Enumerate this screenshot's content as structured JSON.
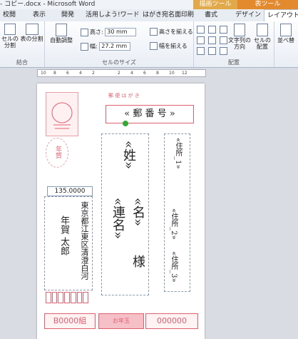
{
  "title": "- コピー.docx - Microsoft Word",
  "context_tabs": {
    "drawing": "描画ツール",
    "table": "表ツール"
  },
  "tabs": [
    "校閲",
    "表示",
    "開発",
    "活用しよう!ワード",
    "はがき宛名面印刷",
    "書式",
    "デザイン",
    "レイアウト"
  ],
  "ribbon": {
    "merge": {
      "split_cells": "セルの\n分割",
      "split_table": "表の分割",
      "label": "結合"
    },
    "size": {
      "autofit": "自動調整",
      "height_label": "高さ:",
      "height_value": "30 mm",
      "width_label": "幅:",
      "width_value": "27.2 mm",
      "distribute_rows": "高さを揃える",
      "distribute_cols": "幅を揃える",
      "label": "セルのサイズ"
    },
    "align": {
      "text_direction": "文字列の\n方向",
      "cell_margins": "セルの\n配置",
      "label": "配置"
    },
    "sort": "並べ替"
  },
  "ruler_numbers": [
    "10",
    "8",
    "6",
    "4",
    "2",
    "",
    "2",
    "4",
    "6",
    "8",
    "10",
    "12"
  ],
  "postcard": {
    "header": "郵 便 は が き",
    "postal_box": "« 郵 番 号 »",
    "nenga": "年賀",
    "amount": "135.0000",
    "sender_address": "東京都江東区清澄白河",
    "sender_name": "年賀 太郎",
    "surname_field": "«姓»",
    "fullname_field": "«連名»",
    "name_field": "«名»",
    "honorific": "様",
    "addr1": "«住所_1»",
    "addr2": "«住所_2»",
    "addr3": "«住所_3»",
    "lottery_group": "B0000組",
    "lottery_mid": "お年玉",
    "lottery_number": "000000"
  }
}
